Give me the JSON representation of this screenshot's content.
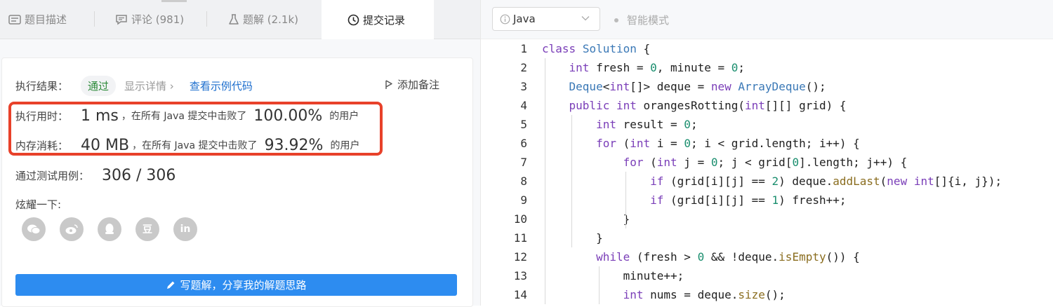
{
  "tabs": [
    {
      "label": "题目描述",
      "icon": "doc-icon"
    },
    {
      "label": "评论 (981)",
      "icon": "comment-icon"
    },
    {
      "label": "题解 (2.1k)",
      "icon": "flask-icon"
    },
    {
      "label": "提交记录",
      "icon": "clock-icon",
      "active": true
    }
  ],
  "result": {
    "label": "执行结果：",
    "status": "通过",
    "detail_link": "显示详情 ›",
    "example_link": "查看示例代码",
    "add_note": "添加备注",
    "time_label": "执行用时：",
    "time_value": "1 ms",
    "time_mid": "，在所有 Java 提交中击败了",
    "time_pct": "100.00%",
    "time_suffix": "的用户",
    "mem_label": "内存消耗：",
    "mem_value": "40 MB",
    "mem_mid": "，在所有 Java 提交中击败了",
    "mem_pct": "93.92%",
    "mem_suffix": "的用户",
    "tests_label": "通过测试用例：",
    "tests_value": "306 / 306",
    "share_label": "炫耀一下:",
    "share_icons": [
      "wechat-icon",
      "weibo-icon",
      "qq-icon",
      "douban-icon",
      "linkedin-icon"
    ],
    "share_glyphs": [
      "",
      "",
      "",
      "豆",
      "in"
    ],
    "write_button": "写题解，分享我的解题思路"
  },
  "editor": {
    "language": "Java",
    "mode": "智能模式",
    "accent": "#e8412a",
    "lines": [
      {
        "n": "1",
        "text": "class Solution {"
      },
      {
        "n": "2",
        "text": "    int fresh = 0, minute = 0;"
      },
      {
        "n": "3",
        "text": "    Deque<int[]> deque = new ArrayDeque();"
      },
      {
        "n": "4",
        "text": "    public int orangesRotting(int[][] grid) {"
      },
      {
        "n": "5",
        "text": "        int result = 0;"
      },
      {
        "n": "6",
        "text": "        for (int i = 0; i < grid.length; i++) {"
      },
      {
        "n": "7",
        "text": "            for (int j = 0; j < grid[0].length; j++) {"
      },
      {
        "n": "8",
        "text": "                if (grid[i][j] == 2) deque.addLast(new int[]{i, j});"
      },
      {
        "n": "9",
        "text": "                if (grid[i][j] == 1) fresh++;"
      },
      {
        "n": "10",
        "text": "            }"
      },
      {
        "n": "11",
        "text": "        }"
      },
      {
        "n": "12",
        "text": "        while (fresh > 0 && !deque.isEmpty()) {"
      },
      {
        "n": "13",
        "text": "            minute++;"
      },
      {
        "n": "14",
        "text": "            int nums = deque.size();"
      }
    ]
  }
}
